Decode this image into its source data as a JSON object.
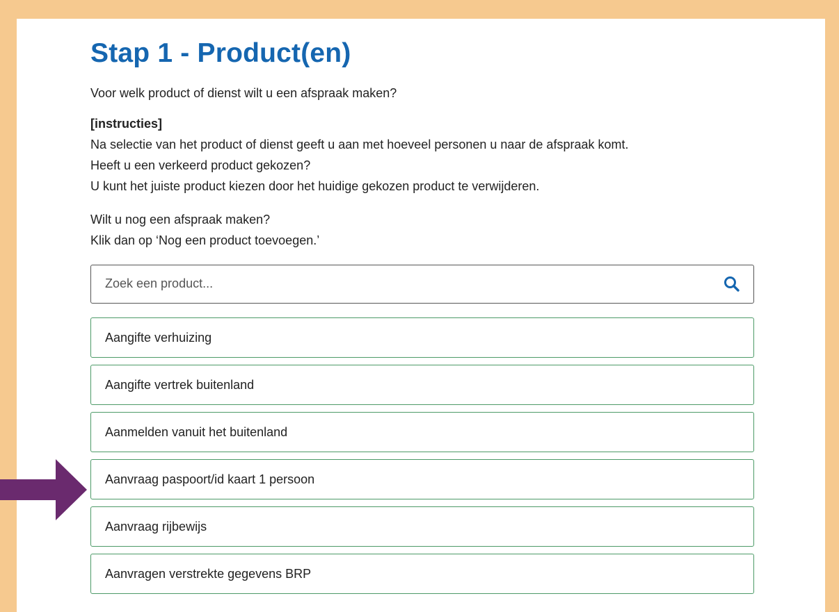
{
  "page": {
    "title": "Stap 1 - Product(en)",
    "question": "Voor welk product of dienst wilt u een afspraak maken?",
    "instructions": {
      "heading": "[instructies]",
      "lines": [
        "Na selectie van het product of dienst geeft u aan met hoeveel personen u naar de afspraak komt.",
        "Heeft u een verkeerd product gekozen?",
        "U kunt het juiste product kiezen door het huidige gekozen product te verwijderen."
      ]
    },
    "more_appointments": {
      "lines": [
        "Wilt u nog een afspraak maken?",
        "Klik dan op ‘Nog een product toevoegen.’"
      ]
    }
  },
  "search": {
    "placeholder": "Zoek een product...",
    "value": "",
    "icon": "search-icon"
  },
  "products": [
    {
      "label": "Aangifte verhuizing"
    },
    {
      "label": "Aangifte vertrek buitenland"
    },
    {
      "label": "Aanmelden vanuit het buitenland"
    },
    {
      "label": "Aanvraag paspoort/id kaart 1 persoon"
    },
    {
      "label": "Aanvraag rijbewijs"
    },
    {
      "label": "Aanvragen verstrekte gegevens BRP"
    }
  ],
  "annotation": {
    "icon": "arrow-right-icon",
    "points_to": "Aanvraag paspoort/id kaart 1 persoon"
  },
  "colors": {
    "frame": "#f6c98f",
    "title": "#1566b0",
    "item_border": "#4c9a67",
    "search_icon": "#1566b0",
    "arrow": "#6a2a6e"
  }
}
